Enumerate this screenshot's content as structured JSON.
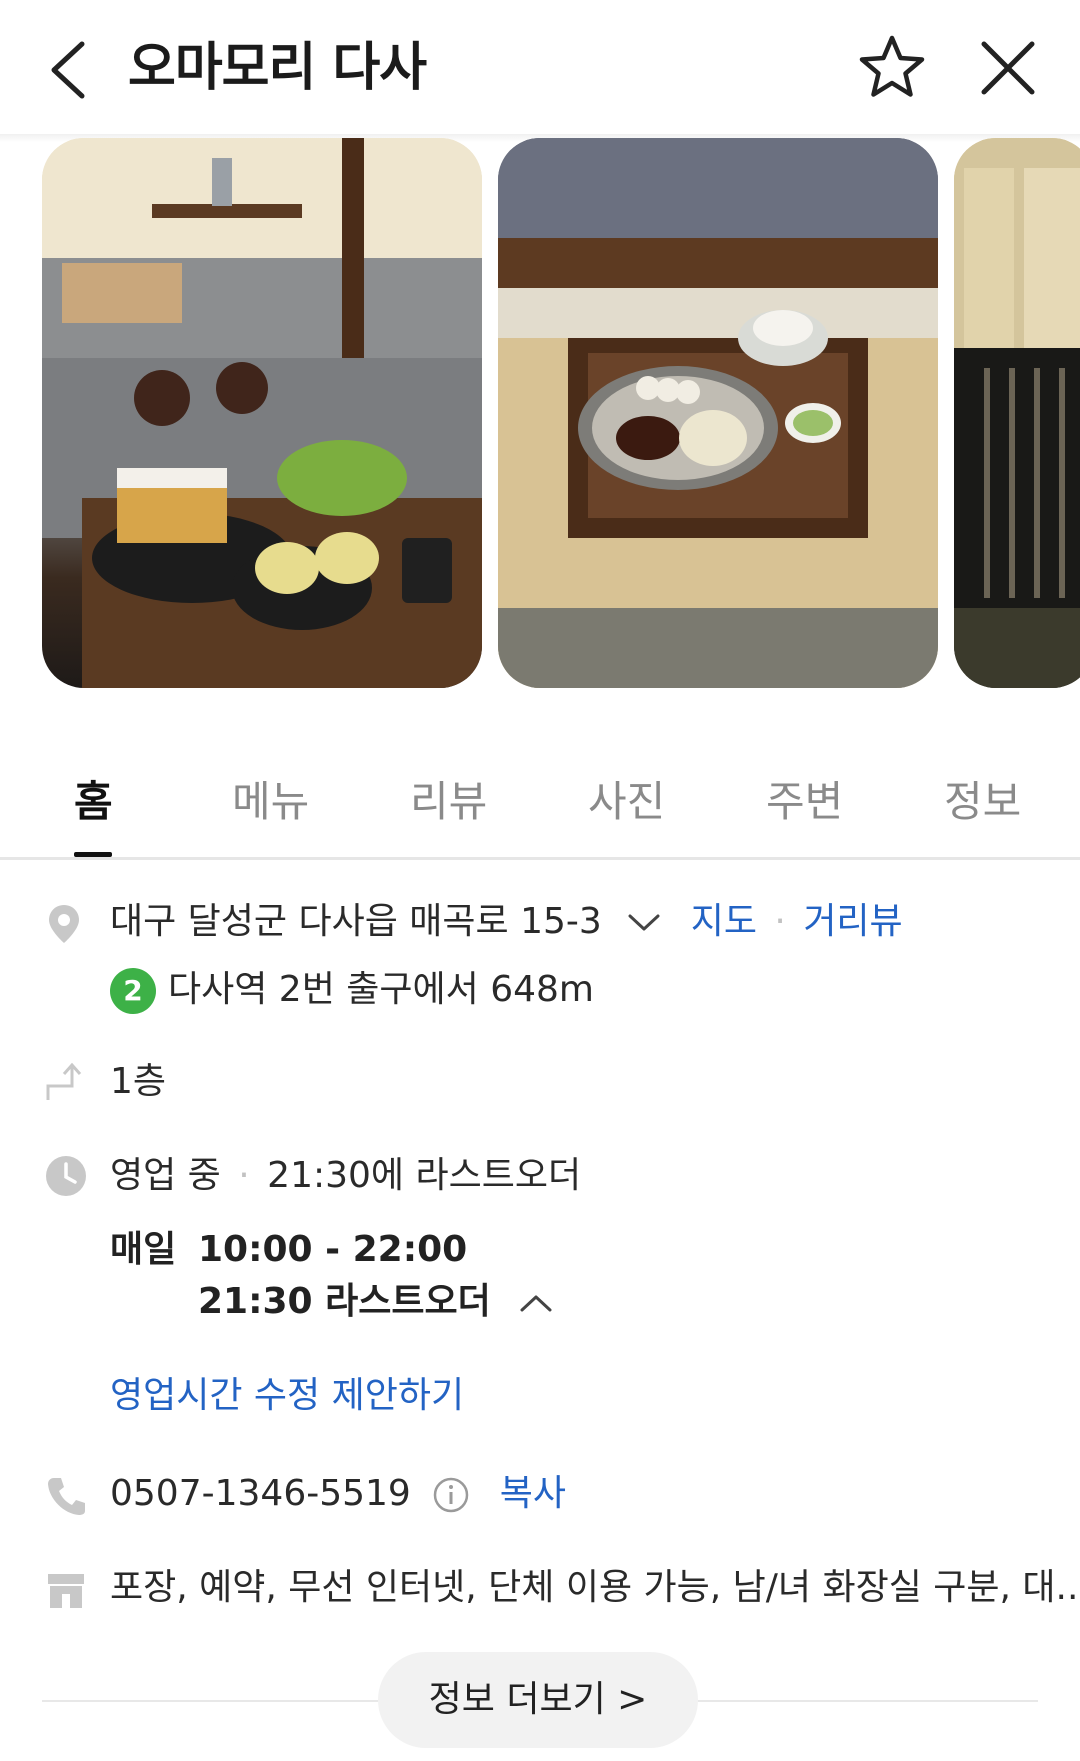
{
  "header": {
    "title": "오마모리 다사",
    "back_icon": "chevron-left-icon",
    "favorite_icon": "star-outline-icon",
    "close_icon": "close-icon"
  },
  "photos": [
    {
      "label": "매장 음식 사진 1"
    },
    {
      "label": "매장 음식 사진 2"
    },
    {
      "label": "매장 외관 사진"
    }
  ],
  "tabs": [
    {
      "label": "홈",
      "active": true
    },
    {
      "label": "메뉴"
    },
    {
      "label": "리뷰"
    },
    {
      "label": "사진"
    },
    {
      "label": "주변"
    },
    {
      "label": "정보"
    }
  ],
  "address": {
    "text": "대구 달성군 다사읍 매곡로 15-3",
    "map_link": "지도",
    "separator": "·",
    "street_view_link": "거리뷰",
    "subway_line": "2",
    "subway_text": "다사역 2번 출구에서 648m",
    "line_color": "#3db147"
  },
  "floor": {
    "text": "1층"
  },
  "hours": {
    "status": "영업 중",
    "separator": "·",
    "last_order_text": "21:30에 라스트오더",
    "day": "매일",
    "time": "10:00 - 22:00",
    "last_order_detail": "21:30 라스트오더",
    "suggest_edit": "영업시간 수정 제안하기"
  },
  "phone": {
    "number": "0507-1346-5519",
    "copy": "복사"
  },
  "amenities": {
    "text": "포장, 예약, 무선 인터넷, 단체 이용 가능, 남/녀 화장실 구분, 대..."
  },
  "more_info": {
    "label": "정보 더보기 >"
  },
  "colors": {
    "link": "#2363c4",
    "active_tab": "#111111",
    "inactive_tab": "#8a8a8a"
  }
}
